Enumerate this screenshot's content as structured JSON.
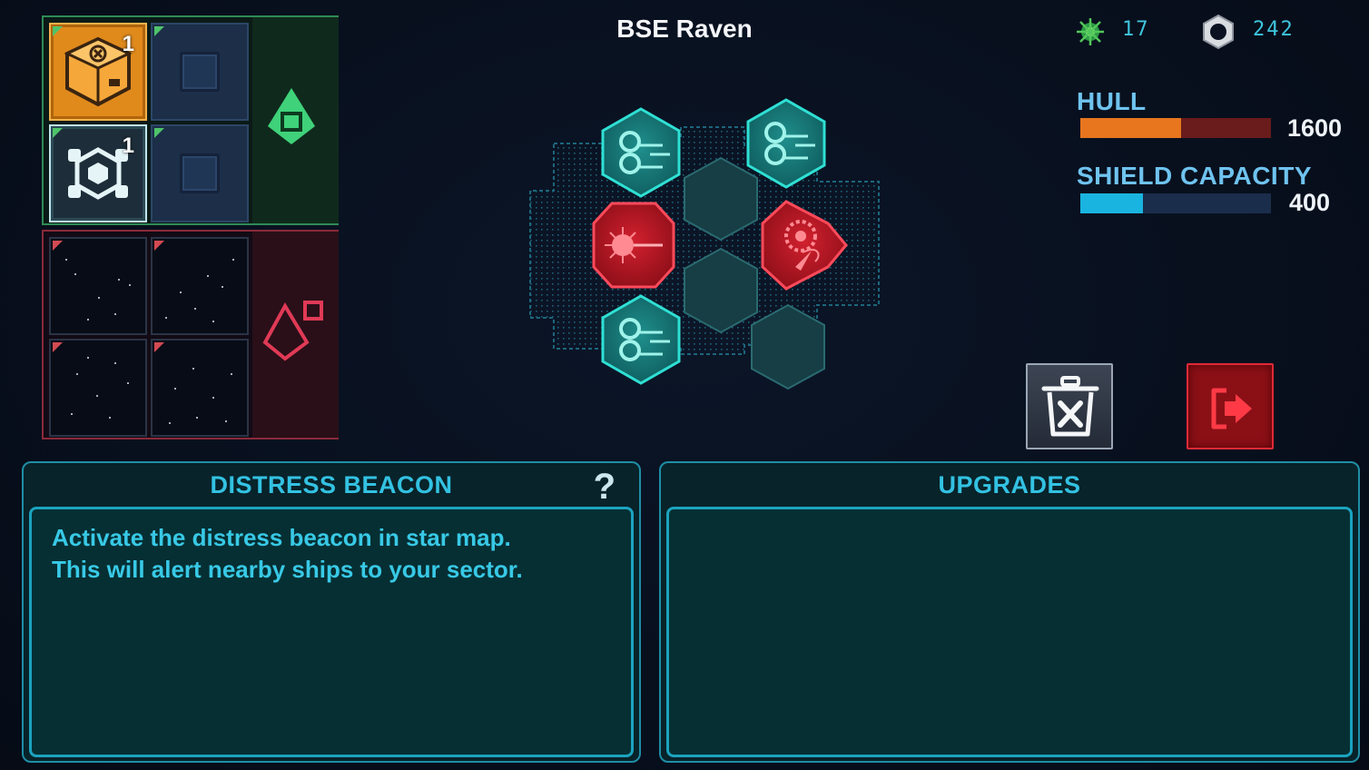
{
  "ship": {
    "name": "BSE Raven"
  },
  "resources": {
    "crystals": {
      "icon": "green-crystal-icon",
      "value": "17"
    },
    "scrap": {
      "icon": "hex-nut-icon",
      "value": "242"
    }
  },
  "stats": {
    "hull": {
      "label": "HULL",
      "value": "1600",
      "fill_fraction": 0.53,
      "color": "#e8761e",
      "track_color": "#6a1b1b"
    },
    "shield": {
      "label": "SHIELD CAPACITY",
      "value": "400",
      "fill_fraction": 0.33,
      "color": "#1ab4e0",
      "track_color": "#1a2d4a"
    }
  },
  "inventory": {
    "equipment_items": [
      {
        "name": "cargo-crate-module",
        "count": "1"
      },
      {
        "name": "shield-generator-module",
        "count": "1"
      },
      {
        "name": "empty-slot"
      },
      {
        "name": "empty-slot"
      }
    ],
    "space_slots": 4
  },
  "ship_layout": {
    "modules": [
      {
        "type": "engine",
        "color": "teal"
      },
      {
        "type": "engine",
        "color": "teal"
      },
      {
        "type": "laser-weapon",
        "color": "red"
      },
      {
        "type": "missile-weapon",
        "color": "red"
      },
      {
        "type": "engine",
        "color": "teal"
      }
    ]
  },
  "buttons": {
    "discard": "trash-icon",
    "exit": "exit-icon"
  },
  "info_panel": {
    "title": "DISTRESS BEACON",
    "help": "?",
    "description_line1": "Activate the distress beacon in star map.",
    "description_line2": "This will alert nearby ships to your sector."
  },
  "upgrades_panel": {
    "title": "UPGRADES"
  },
  "colors": {
    "accent": "#33c2e2",
    "danger": "#e02a36",
    "equipment": "#4fc36a"
  }
}
